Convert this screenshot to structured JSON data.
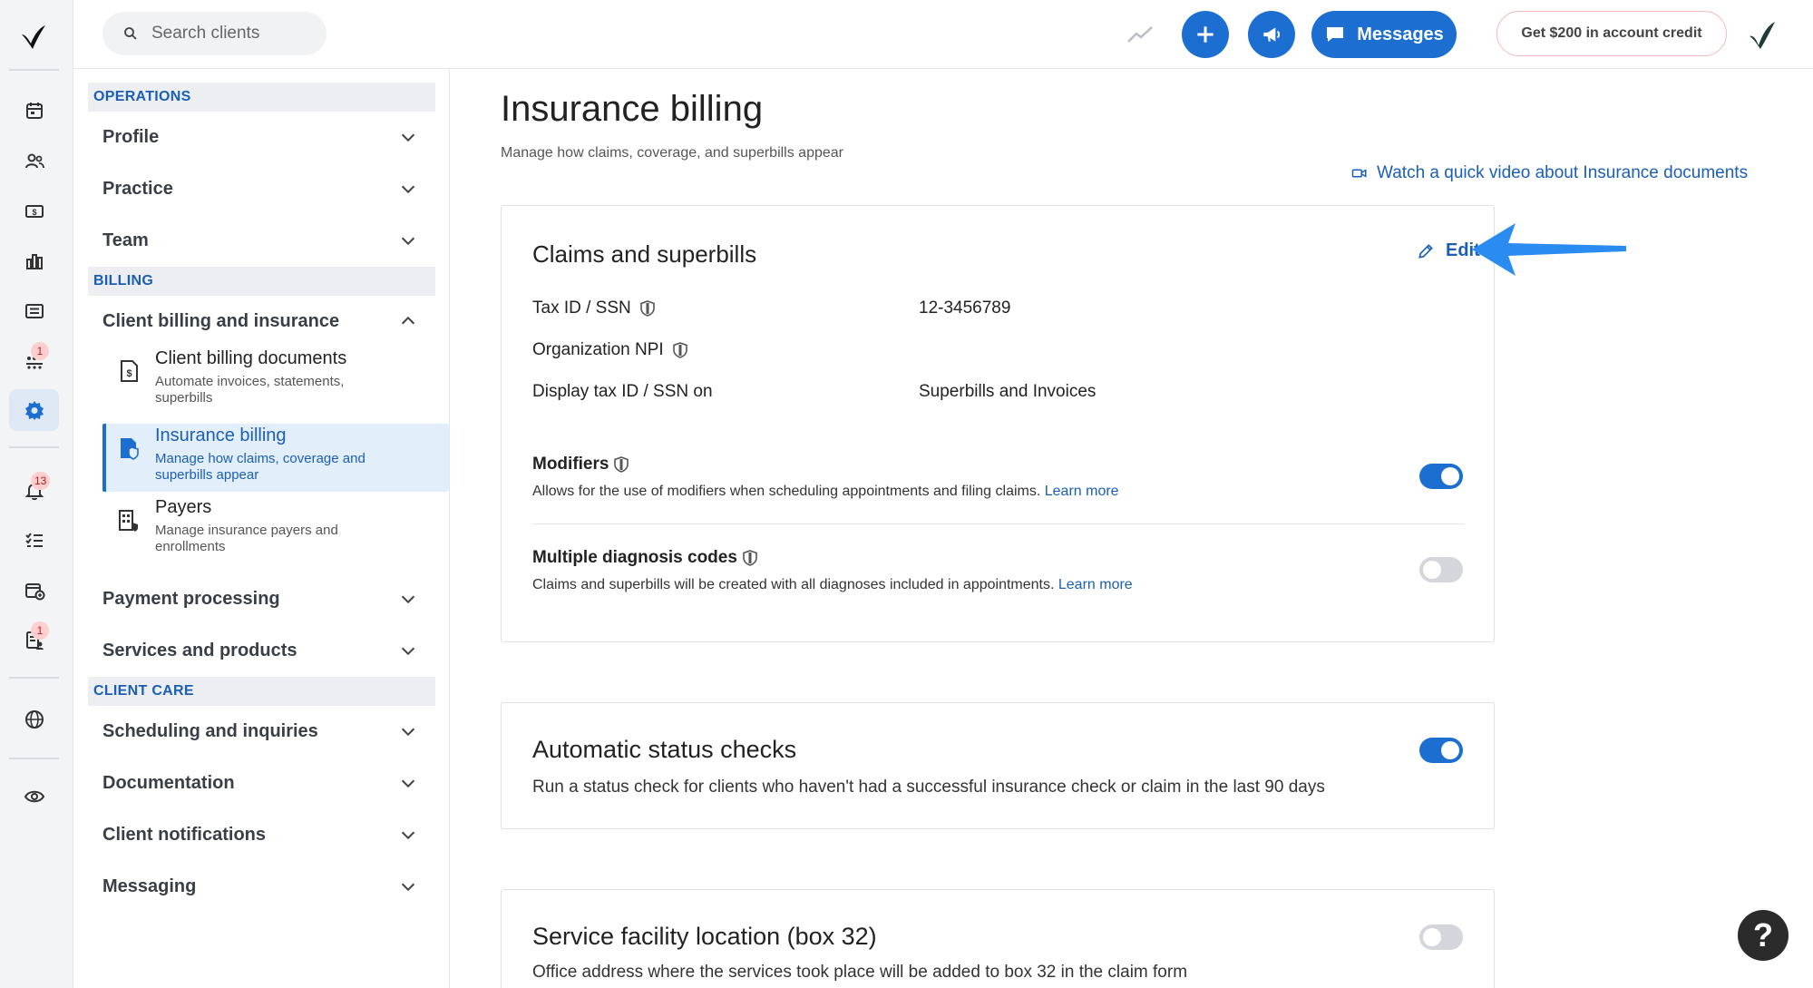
{
  "search": {
    "placeholder": "Search clients"
  },
  "topbar": {
    "messages_label": "Messages",
    "credit_label": "Get $200 in account credit"
  },
  "rail": {
    "badges": {
      "clients": "1",
      "notifications": "13",
      "documents": "1"
    }
  },
  "settings_nav": {
    "sections": {
      "operations": "OPERATIONS",
      "billing": "BILLING",
      "client_care": "CLIENT CARE"
    },
    "items": {
      "profile": "Profile",
      "practice": "Practice",
      "team": "Team",
      "client_billing": "Client billing and insurance",
      "payment_processing": "Payment processing",
      "services": "Services and products",
      "scheduling": "Scheduling and inquiries",
      "documentation": "Documentation",
      "client_notifications": "Client notifications",
      "messaging": "Messaging"
    },
    "sub_items": [
      {
        "title": "Client billing documents",
        "desc": "Automate invoices, statements, superbills"
      },
      {
        "title": "Insurance billing",
        "desc": "Manage how claims, coverage and superbills appear"
      },
      {
        "title": "Payers",
        "desc": "Manage insurance payers and enrollments"
      }
    ]
  },
  "page": {
    "title": "Insurance billing",
    "subtitle": "Manage how claims, coverage, and superbills appear",
    "video_link": "Watch a quick video about Insurance documents"
  },
  "claims_card": {
    "title": "Claims and superbills",
    "edit_label": "Edit",
    "rows": [
      {
        "label": "Tax ID / SSN",
        "value": "12-3456789"
      },
      {
        "label": "Organization NPI",
        "value": ""
      },
      {
        "label": "Display tax ID / SSN on",
        "value": "Superbills and Invoices"
      }
    ],
    "modifiers": {
      "title": "Modifiers",
      "desc": "Allows for the use of modifiers when scheduling appointments and filing claims.",
      "link": "Learn more",
      "enabled": true
    },
    "diagnosis": {
      "title": "Multiple diagnosis codes",
      "desc": "Claims and superbills will be created with all diagnoses included in appointments.",
      "link": "Learn more",
      "enabled": false
    }
  },
  "status_card": {
    "title": "Automatic status checks",
    "desc": "Run a status check for clients who haven't had a successful insurance check or claim in the last 90 days",
    "enabled": true
  },
  "facility_card": {
    "title": "Service facility location (box 32)",
    "desc": "Office address where the services took place will be added to box 32 in the claim form",
    "enabled": false
  },
  "help": {
    "label": "?"
  },
  "colors": {
    "accent": "#1c6fd1",
    "annotation_arrow": "#2a8cf0",
    "section_head": "#1a5fb4"
  }
}
